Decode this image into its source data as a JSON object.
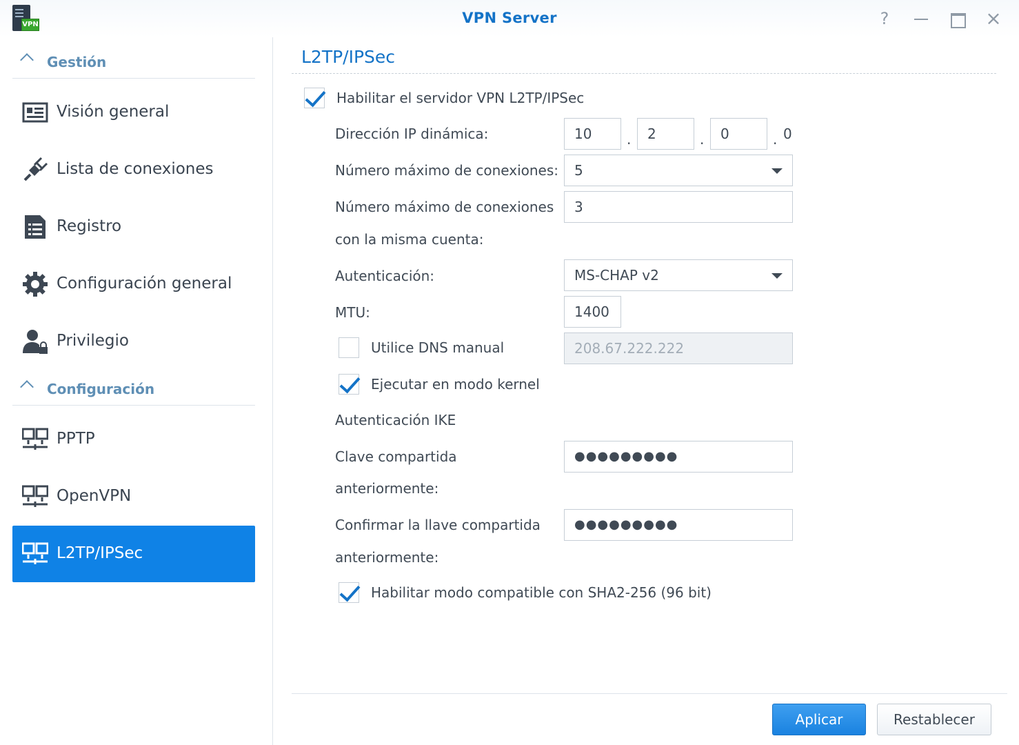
{
  "window": {
    "title": "VPN Server",
    "app_badge": "VPN",
    "help_glyph": "?",
    "close_glyph": "×"
  },
  "sidebar": {
    "sections": [
      {
        "label": "Gestión"
      },
      {
        "label": "Configuración"
      }
    ],
    "items": [
      {
        "label": "Visión general",
        "icon": "overview-icon"
      },
      {
        "label": "Lista de conexiones",
        "icon": "connection-list-icon"
      },
      {
        "label": "Registro",
        "icon": "log-icon"
      },
      {
        "label": "Configuración general",
        "icon": "gear-icon"
      },
      {
        "label": "Privilegio",
        "icon": "user-lock-icon"
      },
      {
        "label": "PPTP",
        "icon": "network-icon"
      },
      {
        "label": "OpenVPN",
        "icon": "network-icon"
      },
      {
        "label": "L2TP/IPSec",
        "icon": "network-icon",
        "active": true
      }
    ]
  },
  "form": {
    "title": "L2TP/IPSec",
    "enable_label": "Habilitar el servidor VPN L2TP/IPSec",
    "enable_checked": true,
    "dynamic_ip_label": "Dirección IP dinámica:",
    "ip_octets": [
      "10",
      "2",
      "0"
    ],
    "ip_separator": ".",
    "ip_last_octet": "0",
    "max_connections_label": "Número máximo de conexiones:",
    "max_connections_value": "5",
    "max_same_account_label_1": "Número máximo de conexiones",
    "max_same_account_label_2": "con la misma cuenta:",
    "max_same_account_value": "3",
    "auth_label": "Autenticación:",
    "auth_value": "MS-CHAP v2",
    "mtu_label": "MTU:",
    "mtu_value": "1400",
    "manual_dns_label": "Utilice DNS manual",
    "manual_dns_checked": false,
    "manual_dns_value": "208.67.222.222",
    "kernel_mode_label": "Ejecutar en modo kernel",
    "kernel_mode_checked": true,
    "ike_auth_label": "Autenticación IKE",
    "psk_label_1": "Clave compartida",
    "psk_label_2": "anteriormente:",
    "psk_value": "●●●●●●●●●",
    "confirm_psk_label_1": "Confirmar la llave compartida",
    "confirm_psk_label_2": "anteriormente:",
    "confirm_psk_value": "●●●●●●●●●",
    "sha2_label": "Habilitar modo compatible con SHA2-256 (96 bit)",
    "sha2_checked": true
  },
  "buttons": {
    "apply": "Aplicar",
    "reset": "Restablecer"
  },
  "colors": {
    "accent": "#1473c7",
    "active_bg": "#0f82e6",
    "section_header": "#5f8fb5"
  }
}
